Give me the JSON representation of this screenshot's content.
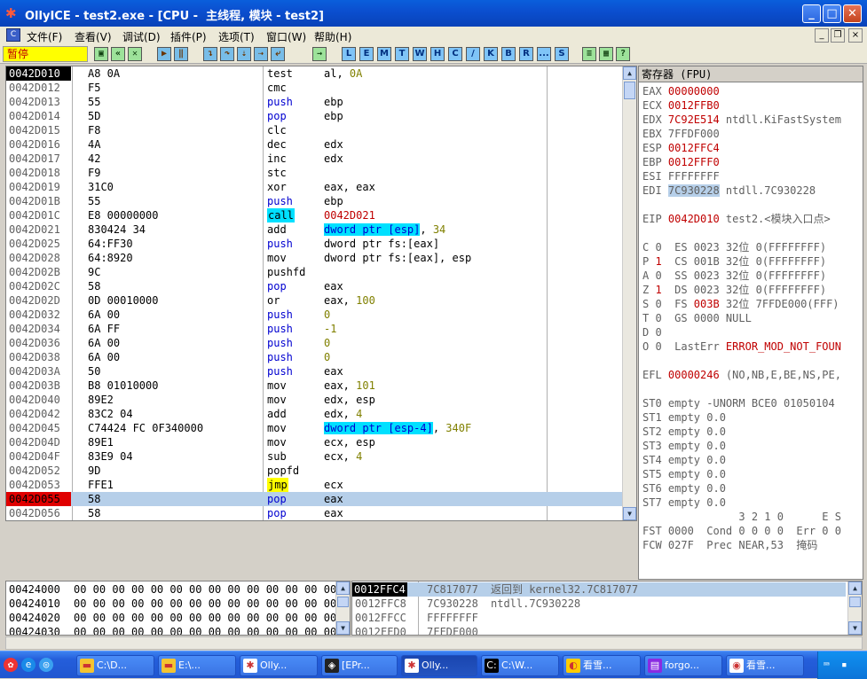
{
  "window": {
    "title": "OllyICE - test2.exe - [CPU -  主线程, 模块 - test2]",
    "minimize": "_",
    "maximize": "□",
    "close": "✕"
  },
  "menu": {
    "icon": "C",
    "items": [
      "文件(F)",
      "查看(V)",
      "调试(D)",
      "插件(P)",
      "选项(T)",
      "窗口(W)",
      "帮助(H)"
    ],
    "mdi_min": "_",
    "mdi_restore": "❐",
    "mdi_close": "×"
  },
  "toolbar": {
    "status": "暂停",
    "letters": [
      "L",
      "E",
      "M",
      "T",
      "W",
      "H",
      "C",
      "/",
      "K",
      "B",
      "R",
      "...",
      "S"
    ]
  },
  "disasm": [
    {
      "addr": "0042D010",
      "hex": "A8 0A",
      "mn": "test",
      "op": [
        [
          "al, ",
          ""
        ],
        [
          "0A",
          "num"
        ]
      ]
    },
    {
      "addr": "0042D012",
      "hex": "F5",
      "mn": "cmc",
      "op": []
    },
    {
      "addr": "0042D013",
      "hex": "55",
      "mn": "push",
      "op": [
        [
          "ebp",
          ""
        ]
      ]
    },
    {
      "addr": "0042D014",
      "hex": "5D",
      "mn": "pop",
      "op": [
        [
          "ebp",
          ""
        ]
      ]
    },
    {
      "addr": "0042D015",
      "hex": "F8",
      "mn": "clc",
      "op": []
    },
    {
      "addr": "0042D016",
      "hex": "4A",
      "mn": "dec",
      "op": [
        [
          "edx",
          ""
        ]
      ]
    },
    {
      "addr": "0042D017",
      "hex": "42",
      "mn": "inc",
      "op": [
        [
          "edx",
          ""
        ]
      ]
    },
    {
      "addr": "0042D018",
      "hex": "F9",
      "mn": "stc",
      "op": []
    },
    {
      "addr": "0042D019",
      "hex": "31C0",
      "mn": "xor",
      "op": [
        [
          "eax, eax",
          ""
        ]
      ]
    },
    {
      "addr": "0042D01B",
      "hex": "55",
      "mn": "push",
      "op": [
        [
          "ebp",
          ""
        ]
      ]
    },
    {
      "addr": "0042D01C",
      "hex": "E8 00000000",
      "mn": "call",
      "op": [
        [
          "0042D021",
          "red"
        ]
      ]
    },
    {
      "addr": "0042D021",
      "hex": "830424 34",
      "mn": "add",
      "op": [
        [
          "dword ptr [esp]",
          "hl"
        ],
        [
          ", ",
          ""
        ],
        [
          "34",
          "num"
        ]
      ]
    },
    {
      "addr": "0042D025",
      "hex": "64:FF30",
      "mn": "push",
      "op": [
        [
          "dword ptr fs:[eax]",
          ""
        ]
      ]
    },
    {
      "addr": "0042D028",
      "hex": "64:8920",
      "mn": "mov",
      "op": [
        [
          "dword ptr fs:[eax], esp",
          ""
        ]
      ]
    },
    {
      "addr": "0042D02B",
      "hex": "9C",
      "mn": "pushfd",
      "op": []
    },
    {
      "addr": "0042D02C",
      "hex": "58",
      "mn": "pop",
      "op": [
        [
          "eax",
          ""
        ]
      ]
    },
    {
      "addr": "0042D02D",
      "hex": "0D 00010000",
      "mn": "or",
      "op": [
        [
          "eax, ",
          ""
        ],
        [
          "100",
          "num"
        ]
      ]
    },
    {
      "addr": "0042D032",
      "hex": "6A 00",
      "mn": "push",
      "op": [
        [
          "0",
          "num"
        ]
      ]
    },
    {
      "addr": "0042D034",
      "hex": "6A FF",
      "mn": "push",
      "op": [
        [
          "-1",
          "num"
        ]
      ]
    },
    {
      "addr": "0042D036",
      "hex": "6A 00",
      "mn": "push",
      "op": [
        [
          "0",
          "num"
        ]
      ]
    },
    {
      "addr": "0042D038",
      "hex": "6A 00",
      "mn": "push",
      "op": [
        [
          "0",
          "num"
        ]
      ]
    },
    {
      "addr": "0042D03A",
      "hex": "50",
      "mn": "push",
      "op": [
        [
          "eax",
          ""
        ]
      ]
    },
    {
      "addr": "0042D03B",
      "hex": "B8 01010000",
      "mn": "mov",
      "op": [
        [
          "eax, ",
          ""
        ],
        [
          "101",
          "num"
        ]
      ]
    },
    {
      "addr": "0042D040",
      "hex": "89E2",
      "mn": "mov",
      "op": [
        [
          "edx, esp",
          ""
        ]
      ]
    },
    {
      "addr": "0042D042",
      "hex": "83C2 04",
      "mn": "add",
      "op": [
        [
          "edx, ",
          ""
        ],
        [
          "4",
          "num"
        ]
      ]
    },
    {
      "addr": "0042D045",
      "hex": "C74424 FC 0F340000",
      "mn": "mov",
      "op": [
        [
          "dword ptr [esp-4]",
          "hl"
        ],
        [
          ", ",
          ""
        ],
        [
          "340F",
          "num"
        ]
      ]
    },
    {
      "addr": "0042D04D",
      "hex": "89E1",
      "mn": "mov",
      "op": [
        [
          "ecx, esp",
          ""
        ]
      ]
    },
    {
      "addr": "0042D04F",
      "hex": "83E9 04",
      "mn": "sub",
      "op": [
        [
          "ecx, ",
          ""
        ],
        [
          "4",
          "num"
        ]
      ]
    },
    {
      "addr": "0042D052",
      "hex": "9D",
      "mn": "popfd",
      "op": []
    },
    {
      "addr": "0042D053",
      "hex": "FFE1",
      "mn": "jmp",
      "op": [
        [
          "ecx",
          ""
        ]
      ]
    },
    {
      "addr": "0042D055",
      "hex": "58",
      "mn": "pop",
      "op": [
        [
          "eax",
          ""
        ]
      ]
    },
    {
      "addr": "0042D056",
      "hex": "58",
      "mn": "pop",
      "op": [
        [
          "eax",
          ""
        ]
      ]
    }
  ],
  "registers": {
    "header": "寄存器 (FPU)",
    "lines": [
      [
        [
          "EAX ",
          "tx"
        ],
        [
          "00000000",
          "rv"
        ]
      ],
      [
        [
          "ECX ",
          "tx"
        ],
        [
          "0012FFB0",
          "rv"
        ]
      ],
      [
        [
          "EDX ",
          "tx"
        ],
        [
          "7C92E514",
          "rv"
        ],
        [
          " ntdll.KiFastSystem",
          "tx"
        ]
      ],
      [
        [
          "EBX ",
          "tx"
        ],
        [
          "7FFDF000",
          "tx"
        ]
      ],
      [
        [
          "ESP ",
          "tx"
        ],
        [
          "0012FFC4",
          "rv"
        ]
      ],
      [
        [
          "EBP ",
          "tx"
        ],
        [
          "0012FFF0",
          "rv"
        ]
      ],
      [
        [
          "ESI ",
          "tx"
        ],
        [
          "FFFFFFFF",
          "tx"
        ]
      ],
      [
        [
          "EDI ",
          "tx"
        ],
        [
          "7C930228",
          "sel"
        ],
        [
          " ntdll.7C930228",
          "tx"
        ]
      ],
      [],
      [
        [
          "EIP ",
          "tx"
        ],
        [
          "0042D010",
          "rv"
        ],
        [
          " test2.<模块入口点>",
          "tx"
        ]
      ],
      [],
      [
        [
          "C 0  ES 0023 32位 0(FFFFFFFF)",
          "tx"
        ]
      ],
      [
        [
          "P ",
          "tx"
        ],
        [
          "1",
          "rv"
        ],
        [
          "  CS 001B 32位 0(FFFFFFFF)",
          "tx"
        ]
      ],
      [
        [
          "A 0  SS 0023 32位 0(FFFFFFFF)",
          "tx"
        ]
      ],
      [
        [
          "Z ",
          "tx"
        ],
        [
          "1",
          "rv"
        ],
        [
          "  DS 0023 32位 0(FFFFFFFF)",
          "tx"
        ]
      ],
      [
        [
          "S 0  FS ",
          "tx"
        ],
        [
          "003B",
          "rv"
        ],
        [
          " 32位 7FFDE000(FFF)",
          "tx"
        ]
      ],
      [
        [
          "T 0  GS 0000 NULL",
          "tx"
        ]
      ],
      [
        [
          "D 0",
          "tx"
        ]
      ],
      [
        [
          "O 0  LastErr ",
          "tx"
        ],
        [
          "ERROR_MOD_NOT_FOUN",
          "rv"
        ]
      ],
      [],
      [
        [
          "EFL ",
          "tx"
        ],
        [
          "00000246",
          "rv"
        ],
        [
          " (NO,NB,E,BE,NS,PE,",
          "tx"
        ]
      ],
      [],
      [
        [
          "ST0 empty -UNORM BCE0 01050104",
          "tx"
        ]
      ],
      [
        [
          "ST1 empty 0.0",
          "tx"
        ]
      ],
      [
        [
          "ST2 empty 0.0",
          "tx"
        ]
      ],
      [
        [
          "ST3 empty 0.0",
          "tx"
        ]
      ],
      [
        [
          "ST4 empty 0.0",
          "tx"
        ]
      ],
      [
        [
          "ST5 empty 0.0",
          "tx"
        ]
      ],
      [
        [
          "ST6 empty 0.0",
          "tx"
        ]
      ],
      [
        [
          "ST7 empty 0.0",
          "tx"
        ]
      ],
      [
        [
          "               3 2 1 0      E S",
          "tx"
        ]
      ],
      [
        [
          "FST 0000  Cond 0 0 0 0  Err 0 0",
          "tx"
        ]
      ],
      [
        [
          "FCW 027F  Prec NEAR,53  掩码",
          "tx"
        ]
      ]
    ]
  },
  "dump": [
    {
      "addr": "00424000",
      "hex": "00 00 00 00 00 00 00 00 00 00 00 00 00 00 00 00 0"
    },
    {
      "addr": "00424010",
      "hex": "00 00 00 00 00 00 00 00 00 00 00 00 00 00 00 00 0"
    },
    {
      "addr": "00424020",
      "hex": "00 00 00 00 00 00 00 00 00 00 00 00 00 00 00 00 0"
    },
    {
      "addr": "00424030",
      "hex": "00 00 00 00 00 00 00 00 00 00 00 00 00 00 00 00 0"
    }
  ],
  "stack": [
    {
      "addr": "0012FFC4",
      "val": "7C817077",
      "cmt": "返回到 kernel32.7C817077",
      "sel": true
    },
    {
      "addr": "0012FFC8",
      "val": "7C930228",
      "cmt": "ntdll.7C930228",
      "sel": false
    },
    {
      "addr": "0012FFCC",
      "val": "FFFFFFFF",
      "cmt": "",
      "sel": false
    },
    {
      "addr": "0012FFD0",
      "val": "7FFDF000",
      "cmt": "",
      "sel": false
    }
  ],
  "taskbar": {
    "items": [
      {
        "label": "C:\\D...",
        "icon": "folder-icon",
        "ic": "▬",
        "bg": "#f4c430",
        "active": false
      },
      {
        "label": "E:\\...",
        "icon": "folder-icon",
        "ic": "▬",
        "bg": "#f4c430",
        "active": false
      },
      {
        "label": "Olly...",
        "icon": "ollydbg-icon",
        "ic": "✱",
        "bg": "#ffffff",
        "active": false
      },
      {
        "label": "[EPr...",
        "icon": "app-icon",
        "ic": "◈",
        "bg": "#222222",
        "active": false
      },
      {
        "label": "Olly...",
        "icon": "ollydbg-icon",
        "ic": "✱",
        "bg": "#ffffff",
        "active": true
      },
      {
        "label": "C:\\W...",
        "icon": "cmd-icon",
        "ic": "C:",
        "bg": "#000000",
        "active": false
      },
      {
        "label": "看雪...",
        "icon": "browser-icon",
        "ic": "◐",
        "bg": "#ffcc00",
        "active": false
      },
      {
        "label": "forgo...",
        "icon": "book-icon",
        "ic": "▤",
        "bg": "#8a2be2",
        "active": false
      },
      {
        "label": "看雪...",
        "icon": "chrome-icon",
        "ic": "◉",
        "bg": "#ffffff",
        "active": false
      }
    ]
  }
}
